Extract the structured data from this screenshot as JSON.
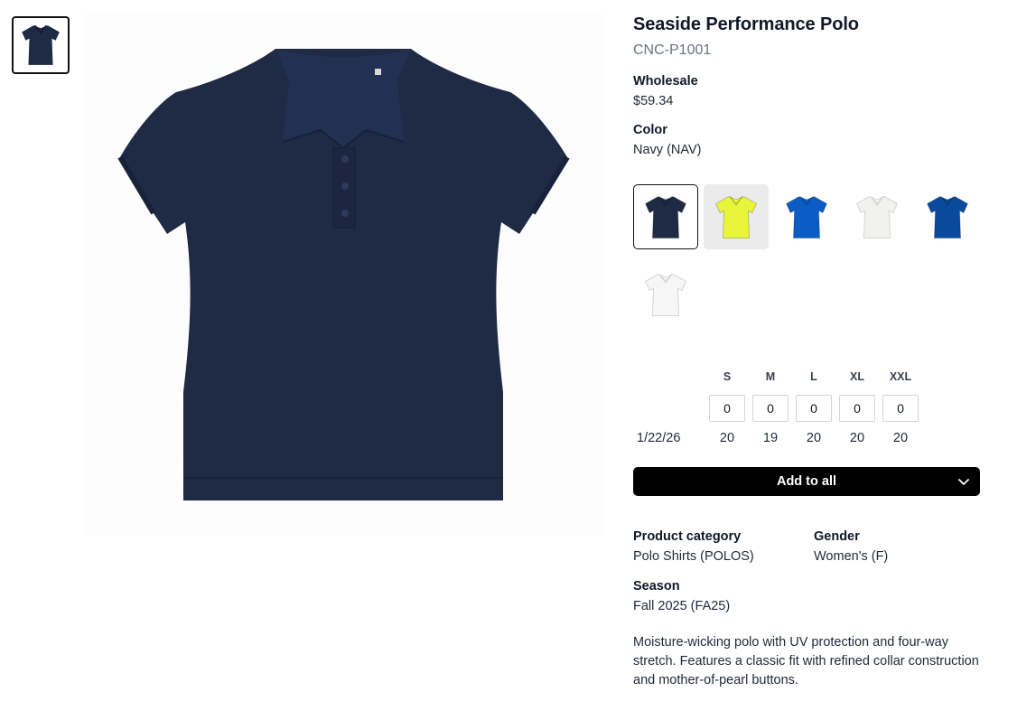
{
  "product": {
    "title": "Seaside Performance Polo",
    "sku": "CNC-P1001",
    "wholesale_label": "Wholesale",
    "wholesale_price": "$59.34",
    "color_label": "Color",
    "color_value": "Navy (NAV)",
    "description": "Moisture-wicking polo with UV protection and four-way stretch. Features a classic fit with refined collar construction and mother-of-pearl buttons."
  },
  "swatches": [
    {
      "name": "navy",
      "color": "#1f2a44",
      "selected": true
    },
    {
      "name": "safety-yellow",
      "color": "#e8f53a",
      "selected": false
    },
    {
      "name": "royal-blue",
      "color": "#0b5cc4",
      "selected": false
    },
    {
      "name": "white",
      "color": "#f1f1ef",
      "selected": false
    },
    {
      "name": "cobalt",
      "color": "#0a4a9c",
      "selected": false
    },
    {
      "name": "white-womens",
      "color": "#f6f6f6",
      "selected": false
    }
  ],
  "sizes": {
    "headers": [
      "S",
      "M",
      "L",
      "XL",
      "XXL"
    ],
    "quantities": [
      "0",
      "0",
      "0",
      "0",
      "0"
    ],
    "stock_date": "1/22/26",
    "stock": [
      "20",
      "19",
      "20",
      "20",
      "20"
    ]
  },
  "add_button": {
    "label": "Add to all"
  },
  "details": {
    "category_label": "Product category",
    "category_value": "Polo Shirts (POLOS)",
    "gender_label": "Gender",
    "gender_value": "Women's (F)",
    "season_label": "Season",
    "season_value": "Fall 2025 (FA25)"
  },
  "colors": {
    "primary_button": "#000000",
    "shirt_navy": "#1f2a44"
  }
}
